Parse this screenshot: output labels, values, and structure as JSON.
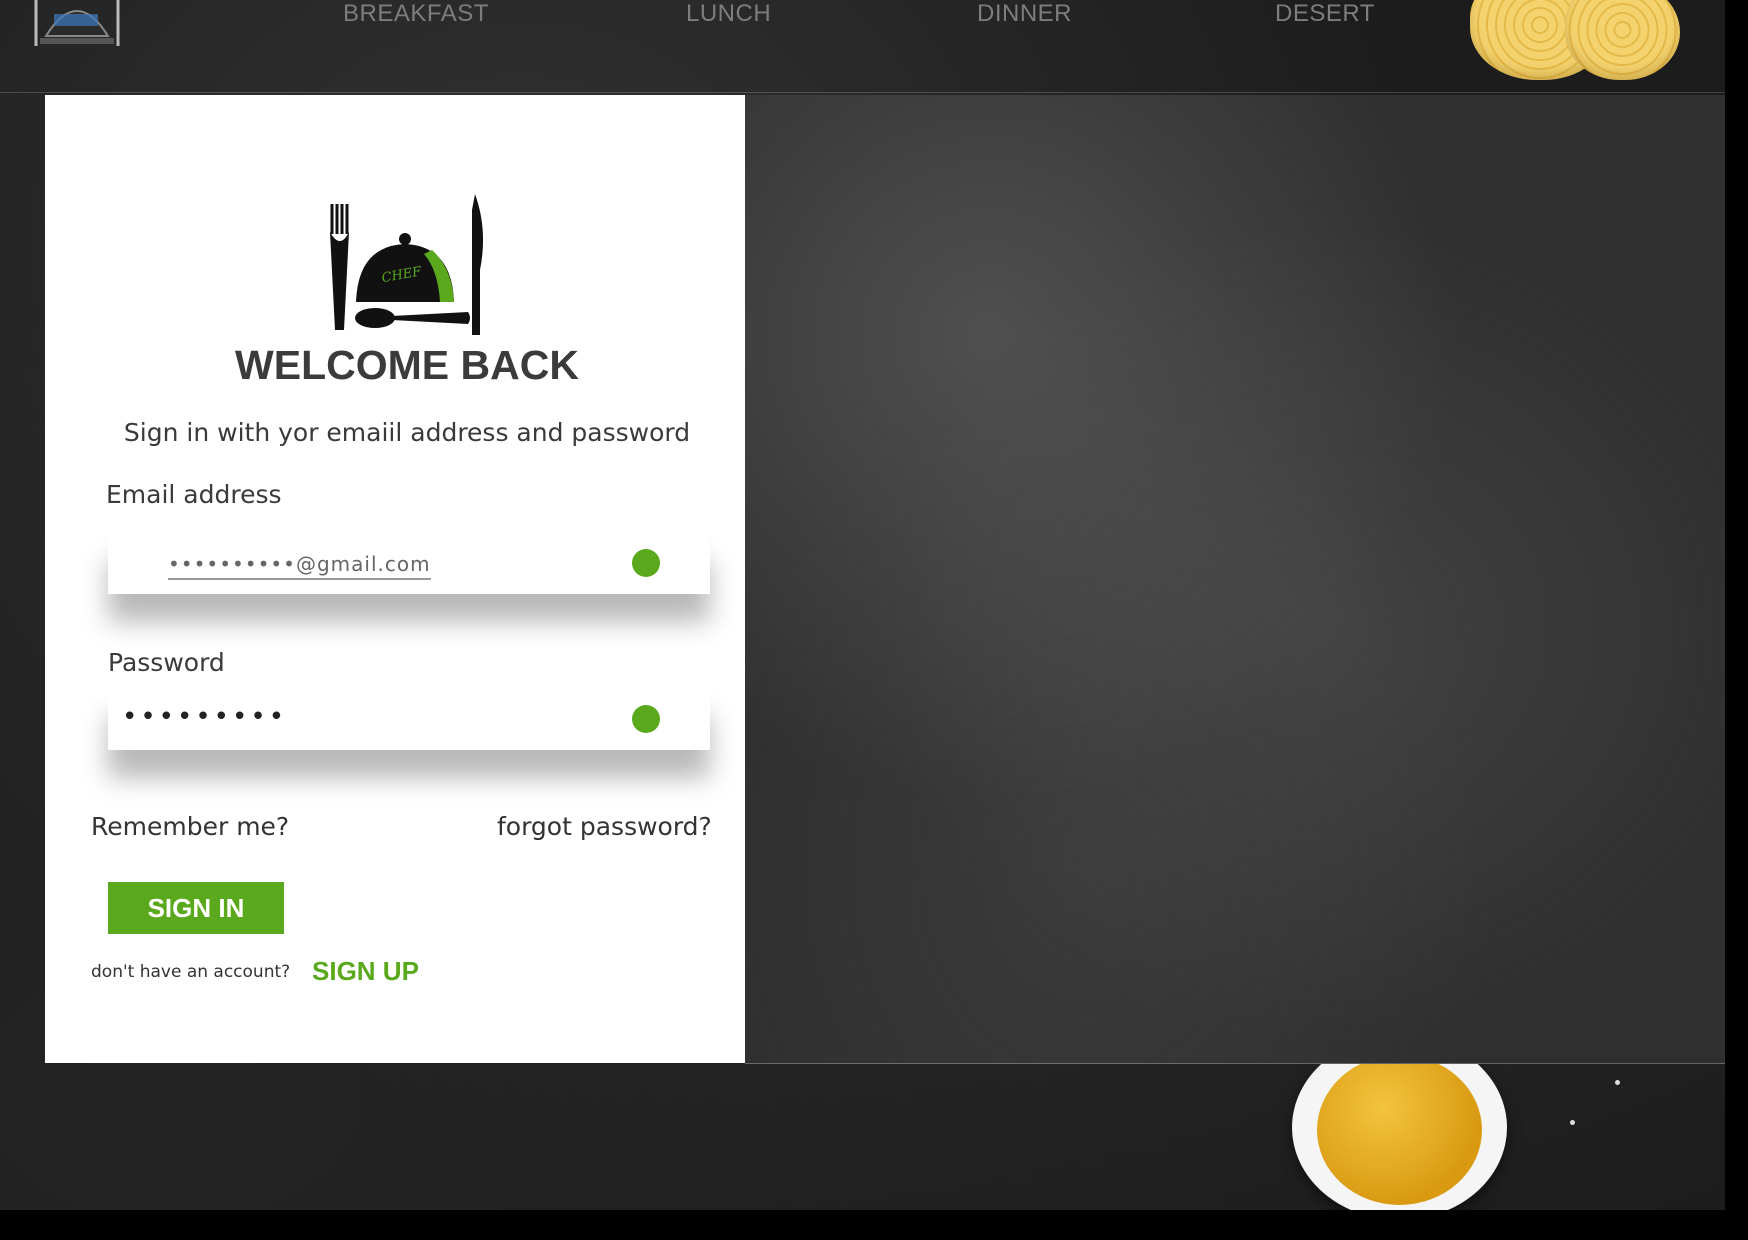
{
  "nav": {
    "items": [
      {
        "label": "BREAKFAST"
      },
      {
        "label": "LUNCH"
      },
      {
        "label": "DINNER"
      },
      {
        "label": "DESERT"
      }
    ]
  },
  "logo": {
    "text": "CHEF",
    "icon": "cloche-with-fork-and-knife"
  },
  "login": {
    "title": "WELCOME BACK",
    "subtitle": "Sign in with yor emaiil address and password",
    "email_label": "Email address",
    "email_value": "••••••••••@gmail.com",
    "password_label": "Password",
    "password_value": "•••••••••",
    "remember_label": "Remember me?",
    "forgot_label": "forgot password?",
    "signin_label": "SIGN IN",
    "no_account_text": "don't have an account?",
    "signup_label": "SIGN UP"
  },
  "colors": {
    "accent": "#5aa91c",
    "background": "#1c1c1d",
    "card": "#ffffff"
  }
}
